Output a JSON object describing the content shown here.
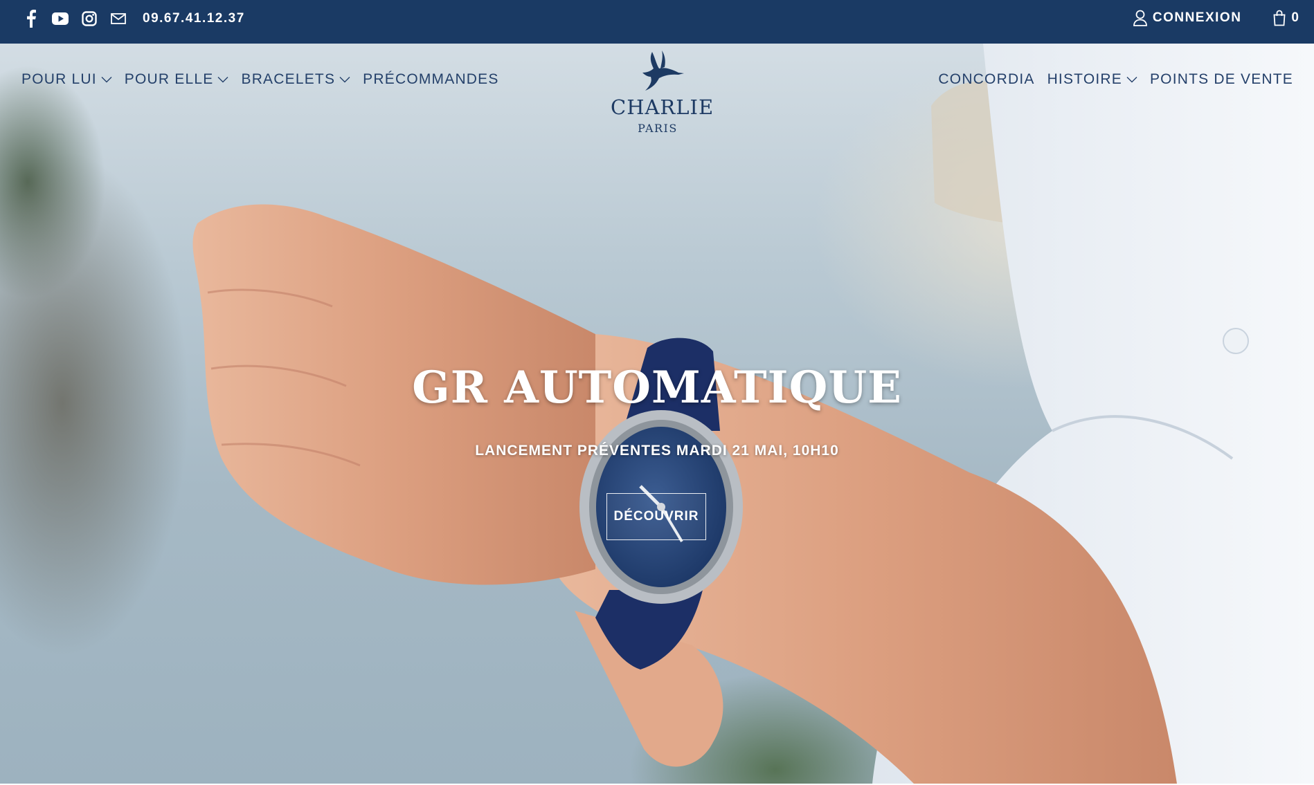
{
  "topbar": {
    "social_icons": [
      "facebook-icon",
      "youtube-icon",
      "instagram-icon",
      "mail-icon"
    ],
    "phone": "09.67.41.12.37",
    "login_label": "CONNEXION",
    "cart_count": "0"
  },
  "logo": {
    "brand": "CHARLIE",
    "city": "PARIS"
  },
  "nav_left": [
    {
      "label": "POUR LUI",
      "dropdown": true
    },
    {
      "label": "POUR ELLE",
      "dropdown": true
    },
    {
      "label": "BRACELETS",
      "dropdown": true
    },
    {
      "label": "PRÉCOMMANDES",
      "dropdown": false
    }
  ],
  "nav_right": [
    {
      "label": "CONCORDIA",
      "dropdown": false
    },
    {
      "label": "HISTOIRE",
      "dropdown": true
    },
    {
      "label": "POINTS DE VENTE",
      "dropdown": false
    }
  ],
  "hero": {
    "title": "GR AUTOMATIQUE",
    "subtitle": "LANCEMENT PRÉVENTES MARDI 21 MAI, 10H10",
    "button_label": "DÉCOUVRIR"
  },
  "colors": {
    "topbar_bg": "#1a3a64",
    "nav_text": "#24406a",
    "hero_text": "#ffffff",
    "watch_strap": "#1c2f66",
    "watch_dial": "#2a4a7e"
  }
}
